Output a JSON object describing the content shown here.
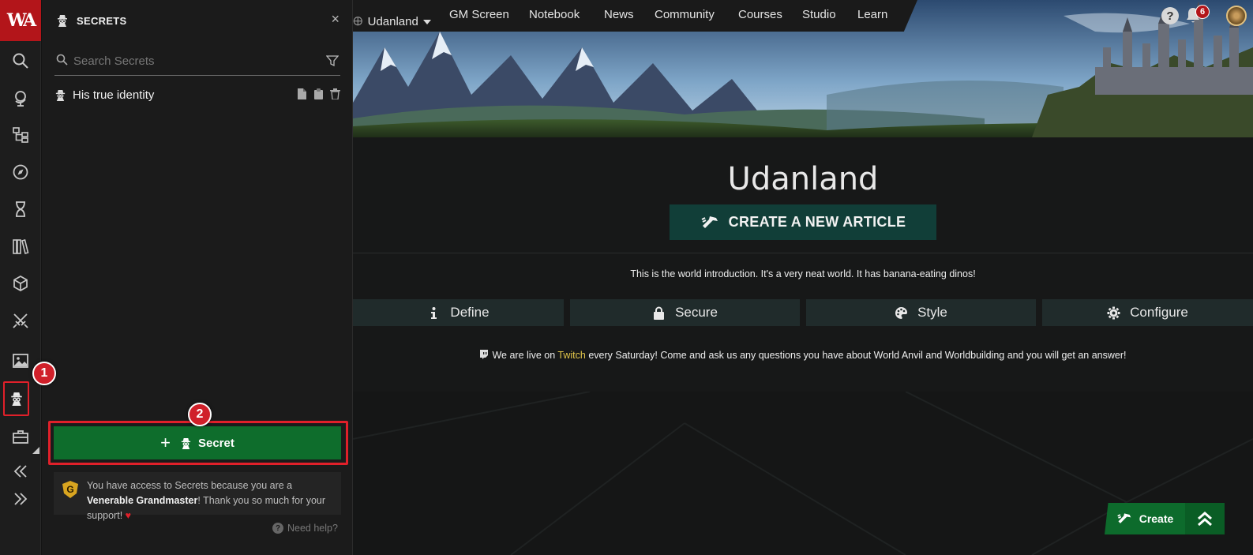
{
  "rail": {
    "logo_text": "WA",
    "items": [
      {
        "name": "search-icon"
      },
      {
        "name": "globe-icon"
      },
      {
        "name": "sitemap-icon"
      },
      {
        "name": "compass-icon"
      },
      {
        "name": "hourglass-icon"
      },
      {
        "name": "books-icon"
      },
      {
        "name": "cube-icon"
      },
      {
        "name": "crossed-swords-icon"
      },
      {
        "name": "image-icon"
      },
      {
        "name": "secrets-icon"
      },
      {
        "name": "toolbox-icon"
      },
      {
        "name": "collapse-icon"
      },
      {
        "name": "expand-icon"
      }
    ],
    "annotation_1": "1"
  },
  "panel": {
    "title": "SECRETS",
    "close": "×",
    "search_placeholder": "Search Secrets",
    "secrets": [
      {
        "label": "His true identity"
      }
    ],
    "annotation_2": "2",
    "new_button_plus": "+",
    "new_button_label": "Secret",
    "support_text_1": "You have access to Secrets because you are a ",
    "support_rank": "Venerable Grandmaster",
    "support_text_2": "! Thank you so much for your support! ",
    "support_heart": "♥",
    "help_q": "?",
    "help_link": "Need help?"
  },
  "topnav": {
    "world": "Udanland",
    "items": [
      "GM Screen",
      "Notebook",
      "News",
      "Community",
      "Courses",
      "Studio",
      "Learn"
    ],
    "help_q": "?",
    "notification_count": "6"
  },
  "content": {
    "world_title": "Udanland",
    "create_article": "CREATE A NEW ARTICLE",
    "intro": "This is the world introduction. It's a very neat world. It has banana-eating dinos!",
    "buttons": [
      {
        "label": "Define",
        "icon": "info-icon"
      },
      {
        "label": "Secure",
        "icon": "lock-icon"
      },
      {
        "label": "Style",
        "icon": "palette-icon"
      },
      {
        "label": "Configure",
        "icon": "gear-icon"
      }
    ],
    "twitch_pre": "We are live on ",
    "twitch_link": "Twitch",
    "twitch_post": " every Saturday! Come and ask us any questions you have about World Anvil and Worldbuilding and you will get an answer!"
  },
  "fab": {
    "create": "Create"
  },
  "colors": {
    "accent_red": "#e0202a",
    "green": "#0e6d2c",
    "teal": "#113e38",
    "twitch_yellow": "#e2c64a"
  }
}
